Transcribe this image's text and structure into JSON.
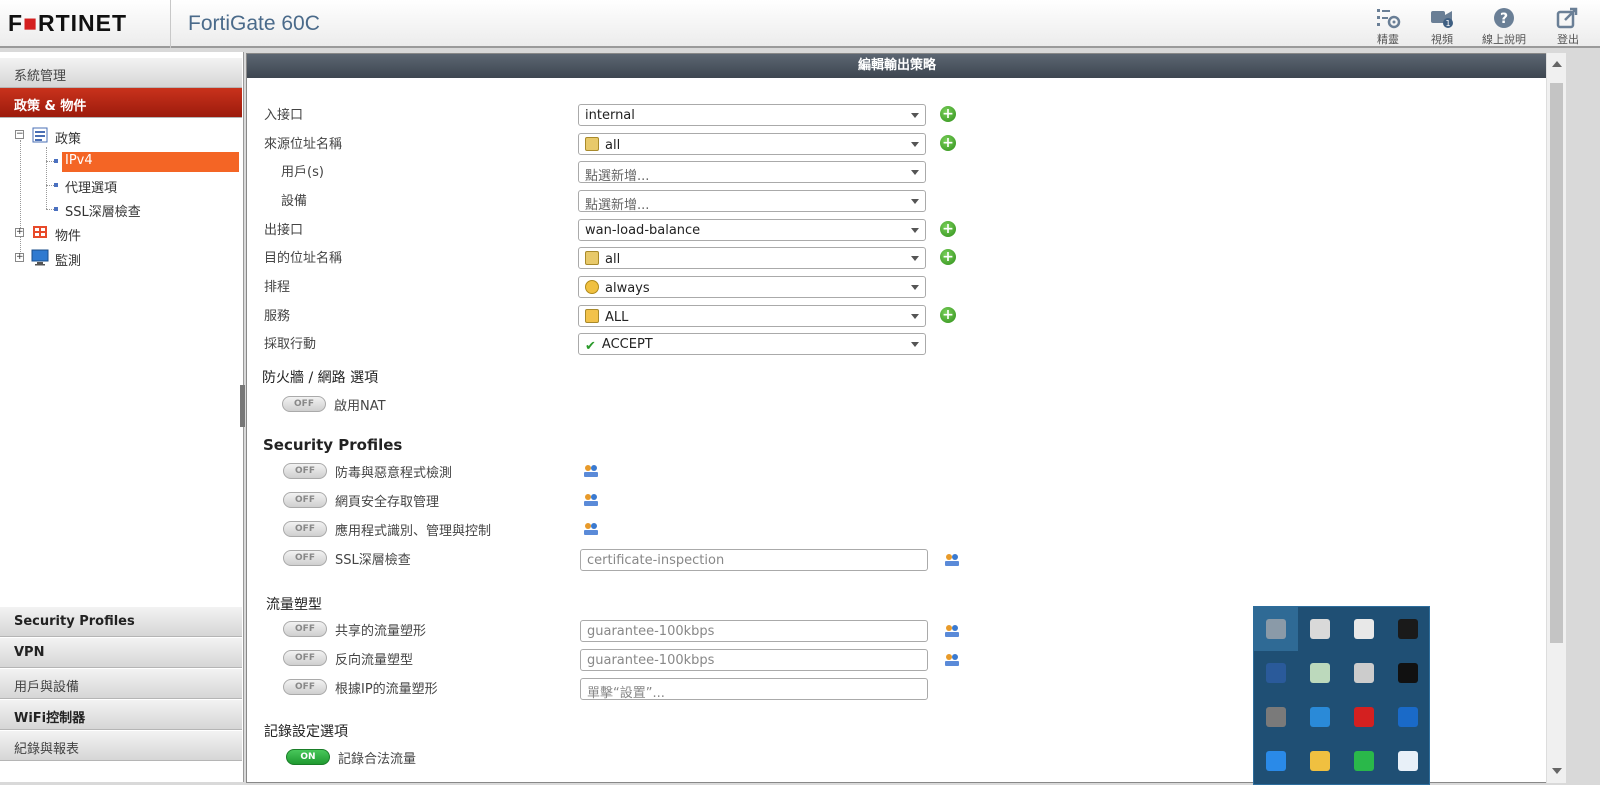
{
  "header": {
    "logo": "F■RTINET",
    "logo_pre": "F",
    "logo_mark": "■",
    "logo_post": "RTINET",
    "product": "FortiGate 60C",
    "buttons": [
      {
        "label": "精靈",
        "icon": "wizard-icon"
      },
      {
        "label": "視頻",
        "icon": "video-icon"
      },
      {
        "label": "線上說明",
        "icon": "help-icon"
      },
      {
        "label": "登出",
        "icon": "logout-icon"
      }
    ]
  },
  "sidebar": {
    "sections_top": [
      "系統管理",
      "政策 & 物件"
    ],
    "tree": {
      "policy": "政策",
      "ipv4": "IPv4",
      "proxy": "代理選項",
      "ssl": "SSL深層檢查",
      "objects": "物件",
      "monitor": "監測"
    },
    "sections_bottom": [
      "Security Profiles",
      "VPN",
      "用戶與設備",
      "WiFi控制器",
      "紀錄與報表"
    ]
  },
  "form": {
    "title": "編輯輸出策略",
    "fields": {
      "in_iface": {
        "label": "入接口",
        "value": "internal"
      },
      "src_addr": {
        "label": "來源位址名稱",
        "value": "all"
      },
      "users": {
        "label": "用戶(s)",
        "value": "點選新增..."
      },
      "devices": {
        "label": "設備",
        "value": "點選新增..."
      },
      "out_iface": {
        "label": "出接口",
        "value": "wan-load-balance"
      },
      "dst_addr": {
        "label": "目的位址名稱",
        "value": "all"
      },
      "schedule": {
        "label": "排程",
        "value": "always"
      },
      "service": {
        "label": "服務",
        "value": "ALL"
      },
      "action": {
        "label": "採取行動",
        "value": "ACCEPT"
      }
    },
    "firewall_section": "防火牆 / 網路 選項",
    "nat": {
      "label": "啟用NAT",
      "state": "OFF"
    },
    "security_section": "Security Profiles",
    "profiles": [
      {
        "label": "防毒與惡意程式檢測",
        "state": "OFF"
      },
      {
        "label": "網頁安全存取管理",
        "state": "OFF"
      },
      {
        "label": "應用程式識別、管理與控制",
        "state": "OFF"
      },
      {
        "label": "SSL深層檢查",
        "state": "OFF",
        "value": "certificate-inspection"
      }
    ],
    "shaping_section": "流量塑型",
    "shaping": [
      {
        "label": "共享的流量塑形",
        "state": "OFF",
        "value": "guarantee-100kbps"
      },
      {
        "label": "反向流量塑型",
        "state": "OFF",
        "value": "guarantee-100kbps"
      },
      {
        "label": "根據IP的流量塑形",
        "state": "OFF",
        "value": "單擊“設置”..."
      }
    ],
    "log_section": "記錄設定選項",
    "log": {
      "label": "記錄合法流量",
      "state": "ON"
    }
  },
  "colors": {
    "brand_red": "#d41f1f",
    "active_nav": "#b02615",
    "tree_selected": "#f46525",
    "toggle_on": "#2ba63c",
    "tray_bg": "#1f4f74"
  },
  "tray_icons": [
    "monitor-icon",
    "kaspersky-icon",
    "copy-icon",
    "nvidia-icon",
    "bluetooth-icon",
    "network-check-icon",
    "speaker-icon",
    "xfire-icon",
    "printer-icon",
    "sync-icon",
    "red-diamond-icon",
    "outlook-icon",
    "dropbox-icon",
    "palette-icon",
    "line-icon",
    "skype-icon"
  ]
}
